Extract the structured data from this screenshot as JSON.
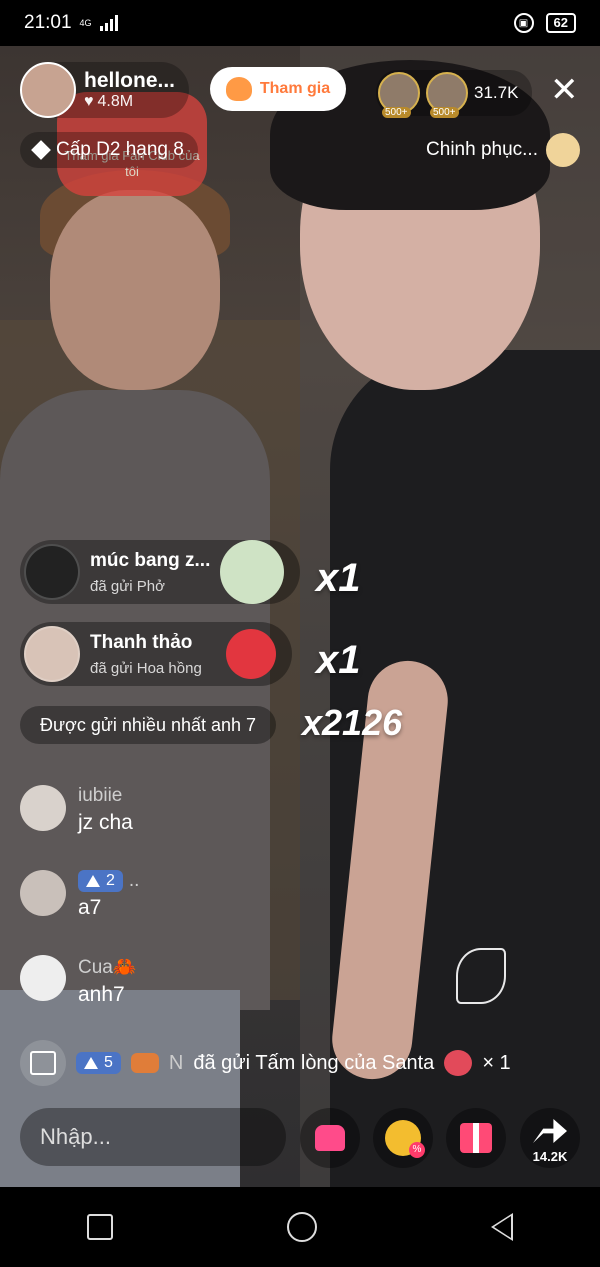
{
  "status_bar": {
    "time": "21:01",
    "network": "4G",
    "battery": "62"
  },
  "host": {
    "name": "hellone...",
    "likes": "4.8M",
    "join_label": "Tham gia"
  },
  "fan_club_sticker": "Tham gia Fan Club của tôi",
  "viewers": {
    "count": "31.7K",
    "badges": [
      "500+",
      "500+"
    ]
  },
  "rank": {
    "label": "Cấp D2 hạng 8"
  },
  "challenge": {
    "label": "Chinh phục..."
  },
  "gifts": [
    {
      "user": "múc bang z...",
      "action": "đã gửi Phở",
      "multiplier": "x1",
      "item_icon": "pho-bowl-icon"
    },
    {
      "user": "Thanh thảo",
      "action": "đã gửi Hoa hồng",
      "multiplier": "x1",
      "item_icon": "rose-icon"
    }
  ],
  "most_sent": {
    "label": "Được gửi nhiều nhất anh 7",
    "count": "x2126"
  },
  "comments": [
    {
      "user": "iubiie",
      "text": "jz cha",
      "level": ""
    },
    {
      "user": "..",
      "text": "a7",
      "level": "2"
    },
    {
      "user": "Cua🦀",
      "text": "anh7",
      "level": ""
    }
  ],
  "gift_message": {
    "level": "5",
    "name": "N",
    "text": "đã gửi Tấm lòng của Santa",
    "count": "× 1"
  },
  "input": {
    "placeholder": "Nhập..."
  },
  "share": {
    "count": "14.2K"
  },
  "colors": {
    "accent": "#ff4a76",
    "join_text": "#ff7a3c",
    "level_badge": "#4b74c5"
  }
}
